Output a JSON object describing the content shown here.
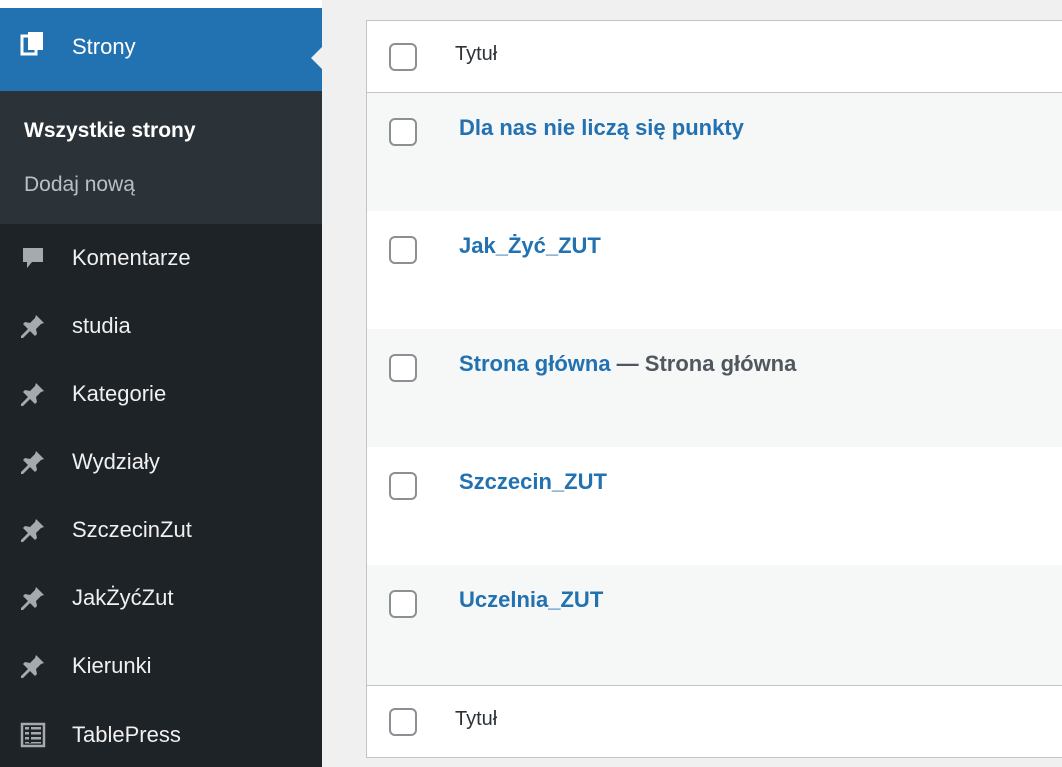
{
  "sidebar": {
    "active": {
      "label": "Strony",
      "icon": "pages-icon"
    },
    "submenu": [
      {
        "label": "Wszystkie strony",
        "current": true
      },
      {
        "label": "Dodaj nową",
        "current": false
      }
    ],
    "items": [
      {
        "label": "Komentarze",
        "icon": "comment-icon"
      },
      {
        "label": "studia",
        "icon": "pin-icon"
      },
      {
        "label": "Kategorie",
        "icon": "pin-icon"
      },
      {
        "label": "Wydziały",
        "icon": "pin-icon"
      },
      {
        "label": "SzczecinZut",
        "icon": "pin-icon"
      },
      {
        "label": "JakŻyćZut",
        "icon": "pin-icon"
      },
      {
        "label": "Kierunki",
        "icon": "pin-icon"
      },
      {
        "label": "TablePress",
        "icon": "table-icon"
      }
    ]
  },
  "table": {
    "header_title": "Tytuł",
    "footer_title": "Tytuł",
    "rows": [
      {
        "title": "Dla nas nie liczą się punkty",
        "state": ""
      },
      {
        "title": "Jak_Żyć_ZUT",
        "state": ""
      },
      {
        "title": "Strona główna",
        "state": " — Strona główna"
      },
      {
        "title": "Szczecin_ZUT",
        "state": ""
      },
      {
        "title": "Uczelnia_ZUT",
        "state": ""
      }
    ]
  },
  "colors": {
    "sidebar_bg": "#1d2327",
    "submenu_bg": "#2c3338",
    "accent": "#2271b1",
    "link": "#2271b1"
  }
}
